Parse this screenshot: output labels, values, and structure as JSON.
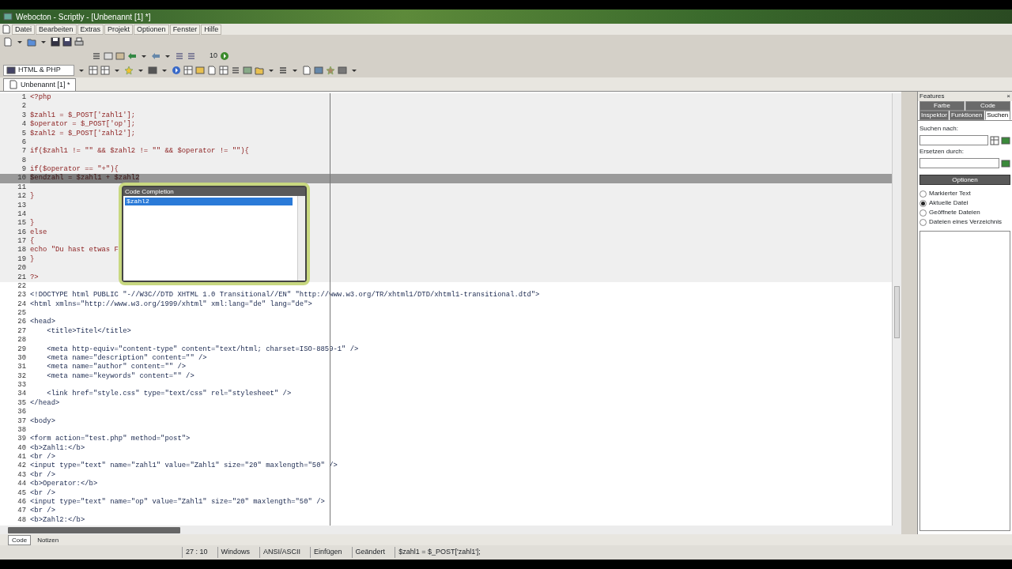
{
  "window": {
    "title": "Webocton - Scriptly - [Unbenannt [1] *]"
  },
  "menu": [
    "Datei",
    "Bearbeiten",
    "Extras",
    "Projekt",
    "Optionen",
    "Fenster",
    "Hilfe"
  ],
  "toolbar": {
    "counter": "10",
    "language": "HTML & PHP"
  },
  "document_tabs": [
    {
      "label": "Unbenannt [1] *",
      "selected": true
    }
  ],
  "editor": {
    "lines": [
      {
        "number": "1",
        "text": "<?php",
        "kind": "php",
        "selected": false
      },
      {
        "number": "2",
        "kind": "php",
        "selected": false
      },
      {
        "number": "3",
        "text": "$zahl1 = $_POST['zahl1'];",
        "kind": "php",
        "selected": false
      },
      {
        "number": "4",
        "text": "$operator = $_POST['op'];",
        "kind": "php",
        "selected": false
      },
      {
        "number": "5",
        "text": "$zahl2 = $_POST['zahl2'];",
        "kind": "php",
        "selected": false
      },
      {
        "number": "6",
        "kind": "php",
        "selected": false
      },
      {
        "number": "7",
        "text": "if($zahl1 != \"\" && $zahl2 != \"\" && $operator != \"\"){",
        "kind": "php",
        "selected": false
      },
      {
        "number": "8",
        "kind": "php",
        "selected": false
      },
      {
        "number": "9",
        "text": "if($operator == \"+\"){",
        "kind": "php",
        "selected": false
      },
      {
        "number": "10",
        "text": "$endzahl = $zahl1 + $zahl2",
        "kind": "php",
        "selected": true
      },
      {
        "number": "11",
        "kind": "php",
        "selected": false
      },
      {
        "number": "12",
        "text": "}",
        "kind": "php",
        "selected": false
      },
      {
        "number": "13",
        "kind": "php",
        "selected": false
      },
      {
        "number": "14",
        "kind": "php",
        "selected": false
      },
      {
        "number": "15",
        "text": "}",
        "kind": "php",
        "selected": false
      },
      {
        "number": "16",
        "text": "else",
        "kind": "php",
        "selected": false
      },
      {
        "number": "17",
        "text": "{",
        "kind": "php",
        "selected": false
      },
      {
        "number": "18",
        "text": "echo \"Du hast etwas F",
        "kind": "php",
        "selected": false
      },
      {
        "number": "19",
        "text": "}",
        "kind": "php",
        "selected": false
      },
      {
        "number": "20",
        "kind": "php",
        "selected": false
      },
      {
        "number": "21",
        "text": "?>",
        "kind": "php",
        "selected": false
      },
      {
        "number": "22",
        "kind": "html",
        "selected": false
      },
      {
        "number": "23",
        "text": "<!DOCTYPE html PUBLIC \"-//W3C//DTD XHTML 1.0 Transitional//EN\" \"http://www.w3.org/TR/xhtml1/DTD/xhtml1-transitional.dtd\">",
        "kind": "html",
        "selected": false
      },
      {
        "number": "24",
        "text": "<html xmlns=\"http://www.w3.org/1999/xhtml\" xml:lang=\"de\" lang=\"de\">",
        "kind": "html",
        "selected": false
      },
      {
        "number": "25",
        "kind": "html",
        "selected": false
      },
      {
        "number": "26",
        "text": "<head>",
        "kind": "html",
        "selected": false
      },
      {
        "number": "27",
        "text": "    <title>Titel</title>",
        "kind": "html",
        "selected": false
      },
      {
        "number": "28",
        "kind": "html",
        "selected": false
      },
      {
        "number": "29",
        "text": "    <meta http-equiv=\"content-type\" content=\"text/html; charset=ISO-8859-1\" />",
        "kind": "html",
        "selected": false
      },
      {
        "number": "30",
        "text": "    <meta name=\"description\" content=\"\" />",
        "kind": "html",
        "selected": false
      },
      {
        "number": "31",
        "text": "    <meta name=\"author\" content=\"\" />",
        "kind": "html",
        "selected": false
      },
      {
        "number": "32",
        "text": "    <meta name=\"keywords\" content=\"\" />",
        "kind": "html",
        "selected": false
      },
      {
        "number": "33",
        "kind": "html",
        "selected": false
      },
      {
        "number": "34",
        "text": "    <link href=\"style.css\" type=\"text/css\" rel=\"stylesheet\" />",
        "kind": "html",
        "selected": false
      },
      {
        "number": "35",
        "text": "</head>",
        "kind": "html",
        "selected": false
      },
      {
        "number": "36",
        "kind": "html",
        "selected": false
      },
      {
        "number": "37",
        "text": "<body>",
        "kind": "html",
        "selected": false
      },
      {
        "number": "38",
        "kind": "html",
        "selected": false
      },
      {
        "number": "39",
        "text": "<form action=\"test.php\" method=\"post\">",
        "kind": "html",
        "selected": false
      },
      {
        "number": "40",
        "text": "<b>Zahl1:</b>",
        "kind": "html",
        "selected": false
      },
      {
        "number": "41",
        "text": "<br />",
        "kind": "html",
        "selected": false
      },
      {
        "number": "42",
        "text": "<input type=\"text\" name=\"zahl1\" value=\"Zahl1\" size=\"20\" maxlength=\"50\" />",
        "kind": "html",
        "selected": false
      },
      {
        "number": "43",
        "text": "<br />",
        "kind": "html",
        "selected": false
      },
      {
        "number": "44",
        "text": "<b>Operator:</b>",
        "kind": "html",
        "selected": false
      },
      {
        "number": "45",
        "text": "<br />",
        "kind": "html",
        "selected": false
      },
      {
        "number": "46",
        "text": "<input type=\"text\" name=\"op\" value=\"Zahl1\" size=\"20\" maxlength=\"50\" />",
        "kind": "html",
        "selected": false
      },
      {
        "number": "47",
        "text": "<br />",
        "kind": "html",
        "selected": false
      },
      {
        "number": "48",
        "text": "<b>Zahl2:</b>",
        "kind": "html",
        "selected": false
      }
    ]
  },
  "code_completion": {
    "title": "Code Completion",
    "items": [
      {
        "label": "$zahl2",
        "selected": true
      }
    ]
  },
  "features_panel": {
    "title": "Features",
    "close": "×",
    "tabs_row_1": [
      {
        "label": "Farbe",
        "selected": false
      },
      {
        "label": "Code",
        "selected": false
      }
    ],
    "tabs_row_2": [
      {
        "label": "Inspektor",
        "selected": false
      },
      {
        "label": "Funktionen",
        "selected": false
      },
      {
        "label": "Suchen",
        "selected": true
      }
    ],
    "search_label": "Suchen nach:",
    "replace_label": "Ersetzen durch:",
    "options_button": "Optionen",
    "scope": [
      {
        "label": "Markierter Text",
        "selected": false
      },
      {
        "label": "Aktuelle Datei",
        "selected": true
      },
      {
        "label": "Geöffnete Dateien",
        "selected": false
      },
      {
        "label": "Dateien eines Verzeichnis",
        "selected": false
      }
    ]
  },
  "bottom_tabs": [
    {
      "label": "Code",
      "selected": true
    },
    {
      "label": "Notizen",
      "selected": false
    }
  ],
  "status_bar": [
    "27 : 10",
    "Windows",
    "ANSI/ASCII",
    "Einfügen",
    "Geändert",
    "$zahl1 = $_POST['zahl1'];"
  ]
}
